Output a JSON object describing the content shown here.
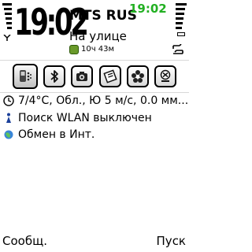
{
  "status": {
    "clock": "19:02",
    "secondary_clock": "19:02",
    "operator": "MTS RUS",
    "profile": "На улице",
    "timer": "10ч 43м",
    "secondary_clock_color": "#22b022"
  },
  "shortcuts": {
    "items": [
      {
        "icon": "connectivity-icon",
        "selected": true
      },
      {
        "icon": "bluetooth-icon",
        "selected": false
      },
      {
        "icon": "camera-icon",
        "selected": false
      },
      {
        "icon": "notes-icon",
        "selected": false
      },
      {
        "icon": "flower-icon",
        "selected": false
      },
      {
        "icon": "xpress-icon",
        "selected": false
      }
    ]
  },
  "info": {
    "weather": "7/4°C, Обл., Ю 5 м/с, 0.0 мм...",
    "wlan": "Поиск WLAN выключен",
    "internet": "Обмен в Инт."
  },
  "softkeys": {
    "left": "Сообщ.",
    "right": "Пуск"
  }
}
